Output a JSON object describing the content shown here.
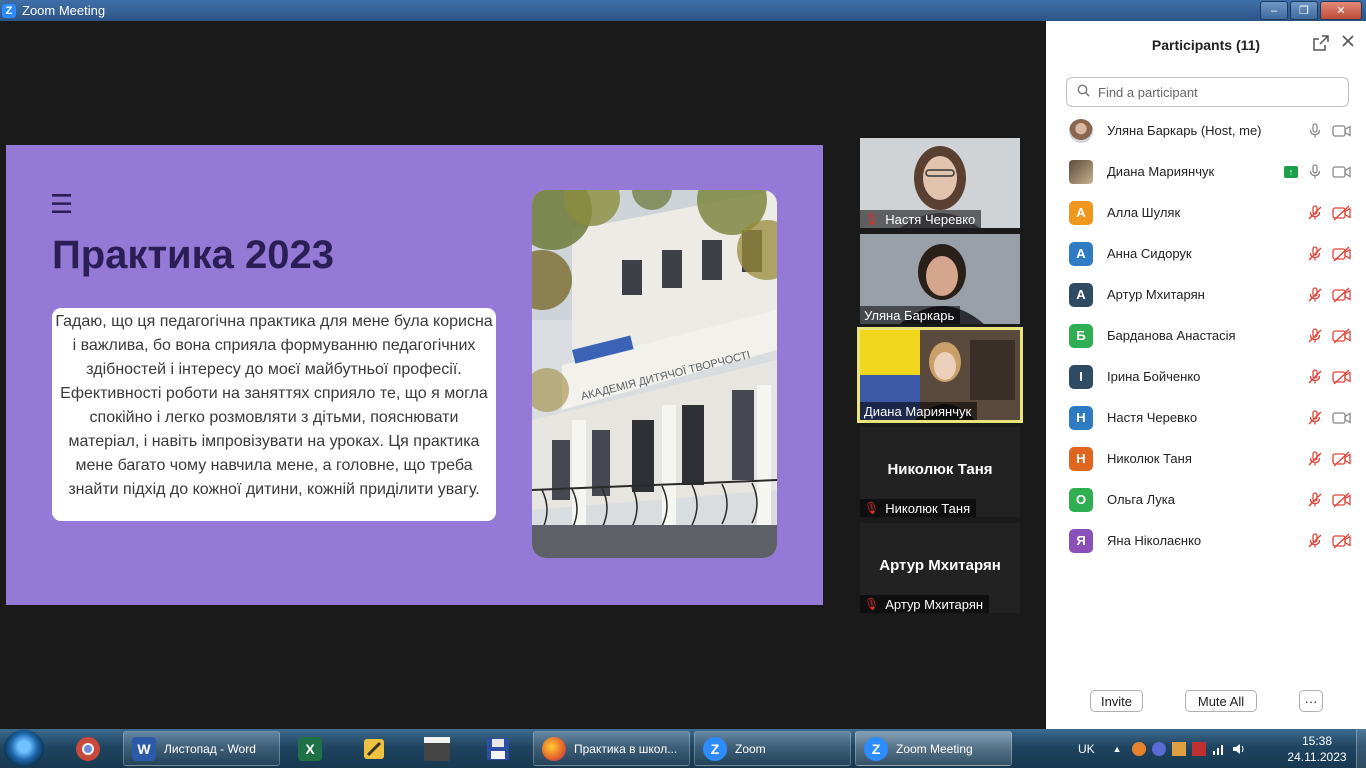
{
  "window": {
    "title": "Zoom Meeting",
    "logo_letter": "Z",
    "minimize": "–",
    "restore": "❐",
    "close": "✕"
  },
  "slide": {
    "menu_icon": "☰",
    "title": "Практика 2023",
    "text": "Гадаю, що ця педагогічна практика для мене була корисна і важлива, бо вона сприяла формуванню педагогічних здібностей і інтересу до моєї майбутньої професії. Ефективності роботи на заняттях сприяло те, що я могла спокійно і легко розмовляти з дітьми, пояснювати матеріал, і навіть імпровізувати на уроках. Ця практика мене багато чому навчила мене, а головне, що треба знайти підхід до кожної дитини, кожній приділити увагу.",
    "photo_sign": "АКАДЕМІЯ ДИТЯЧОЇ ТВОРЧОСТІ"
  },
  "video_tiles": [
    {
      "name": "Настя Черевко",
      "muted": true
    },
    {
      "name": "Уляна Баркарь",
      "muted": false
    },
    {
      "name": "Диана Мариянчук",
      "muted": false
    },
    {
      "name": "Николюк Таня",
      "big_name": "Николюк Таня",
      "muted": true
    },
    {
      "name": "Артур Мхитарян",
      "big_name": "Артур Мхитарян",
      "muted": true
    }
  ],
  "panel": {
    "title": "Participants (11)",
    "search_placeholder": "Find a participant",
    "participants": [
      {
        "name": "Уляна Баркарь (Host, me)",
        "avatar": "",
        "color": "",
        "mic": "on",
        "cam": "on"
      },
      {
        "name": "Диана Мариянчук",
        "avatar": "",
        "color": "",
        "mic": "on",
        "cam": "on",
        "sharing": true
      },
      {
        "name": "Алла Шуляк",
        "avatar": "А",
        "color": "#f0961e",
        "mic": "off",
        "cam": "off"
      },
      {
        "name": "Анна Сидорук",
        "avatar": "А",
        "color": "#2e7bc4",
        "mic": "off",
        "cam": "off"
      },
      {
        "name": "Артур Мхитарян",
        "avatar": "А",
        "color": "#2f4a63",
        "mic": "off",
        "cam": "off"
      },
      {
        "name": "Барданова Анастасія",
        "avatar": "Б",
        "color": "#2fae52",
        "mic": "off",
        "cam": "off"
      },
      {
        "name": "Ірина Бойченко",
        "avatar": "І",
        "color": "#2f4a63",
        "mic": "off",
        "cam": "off"
      },
      {
        "name": "Настя Черевко",
        "avatar": "Н",
        "color": "#2e7bc4",
        "mic": "off",
        "cam": "on"
      },
      {
        "name": "Николюк Таня",
        "avatar": "Н",
        "color": "#e0661f",
        "mic": "off",
        "cam": "off"
      },
      {
        "name": "Ольга Лука",
        "avatar": "О",
        "color": "#2fae52",
        "mic": "off",
        "cam": "off"
      },
      {
        "name": "Яна Ніколаєнко",
        "avatar": "Я",
        "color": "#8b4fb8",
        "mic": "off",
        "cam": "off"
      }
    ],
    "invite": "Invite",
    "mute_all": "Mute All",
    "more": "···"
  },
  "taskbar": {
    "items": [
      {
        "label": "Листопад - Word",
        "icon": "W",
        "color": "#2b5aa8"
      },
      {
        "label": "Практика в школ...",
        "icon": "",
        "color": "#e6602a"
      },
      {
        "label": "Zoom",
        "icon": "Z",
        "color": "#2d8cff"
      },
      {
        "label": "Zoom Meeting",
        "icon": "Z",
        "color": "#2d8cff"
      }
    ],
    "quick": [
      {
        "icon": "X",
        "color": "#1e7145"
      },
      {
        "icon": "321",
        "color": "#555"
      }
    ],
    "lang": "UK",
    "time": "15:38",
    "date": "24.11.2023"
  }
}
